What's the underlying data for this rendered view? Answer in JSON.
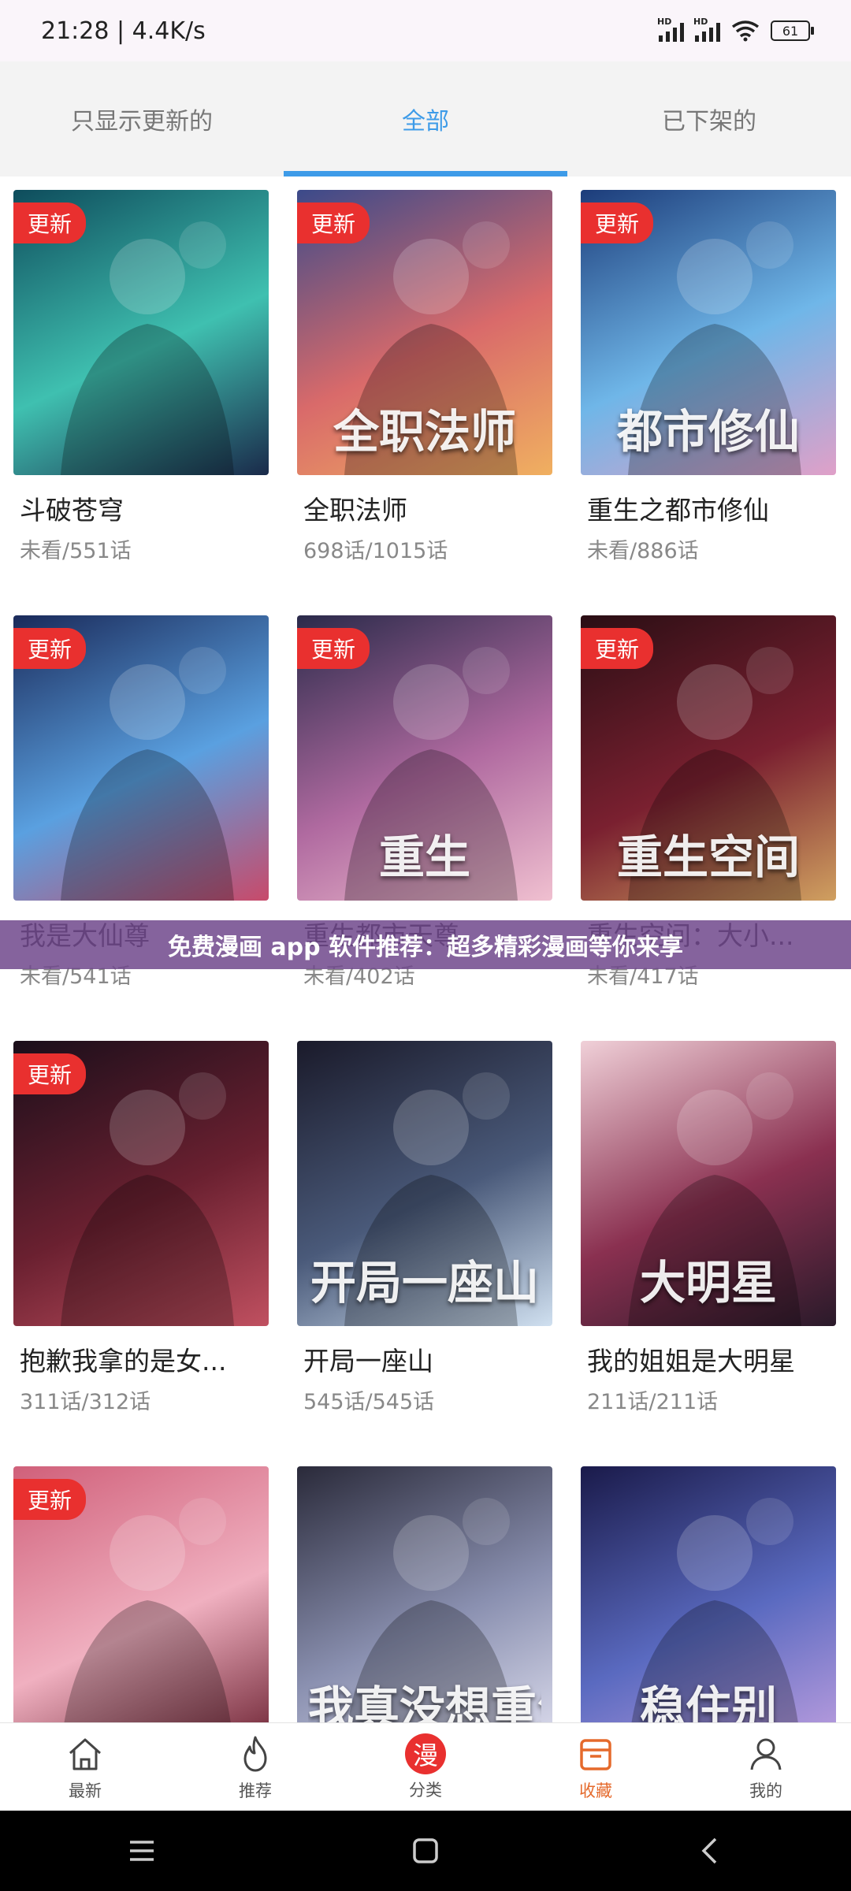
{
  "status_bar": {
    "time": "21:28",
    "speed": "4.4K/s",
    "separator": "|",
    "signal_label": "HD",
    "battery": "61"
  },
  "tabs": [
    {
      "label": "只显示更新的",
      "active": false
    },
    {
      "label": "全部",
      "active": true
    },
    {
      "label": "已下架的",
      "active": false
    }
  ],
  "badge_label": "更新",
  "comics": [
    {
      "name": "斗破苍穹",
      "progress": "未看/551话",
      "badge": true,
      "cover_text": "",
      "colors": [
        "#0e4c5c",
        "#3fc0b0",
        "#1a2a4a"
      ]
    },
    {
      "name": "全职法师",
      "progress": "698话/1015话",
      "badge": true,
      "cover_text": "全职法师",
      "colors": [
        "#3b4a8a",
        "#d96a6a",
        "#f0b060"
      ]
    },
    {
      "name": "重生之都市修仙",
      "progress": "未看/886话",
      "badge": true,
      "cover_text": "都市修仙",
      "colors": [
        "#1c3c7a",
        "#6fb6e8",
        "#e0a0c8"
      ]
    },
    {
      "name": "我是大仙尊",
      "progress": "未看/541话",
      "badge": true,
      "cover_text": "",
      "colors": [
        "#1a2a5a",
        "#5aa0e0",
        "#c84a6a"
      ]
    },
    {
      "name": "重生都市天尊",
      "progress": "未看/402话",
      "badge": true,
      "cover_text": "重生",
      "colors": [
        "#2a2a4a",
        "#b06aa0",
        "#f0c0d0"
      ]
    },
    {
      "name": "重生空间：大小...",
      "progress": "未看/417话",
      "badge": true,
      "cover_text": "重生空间",
      "colors": [
        "#2a0e14",
        "#7a2030",
        "#d0a060"
      ]
    },
    {
      "name": "抱歉我拿的是女...",
      "progress": "311话/312话",
      "badge": true,
      "cover_text": "",
      "colors": [
        "#1a0e1a",
        "#6a2030",
        "#c05060"
      ]
    },
    {
      "name": "开局一座山",
      "progress": "545话/545话",
      "badge": false,
      "cover_text": "开局一座山",
      "colors": [
        "#1a1a2a",
        "#4a5a7a",
        "#d0e0f0"
      ]
    },
    {
      "name": "我的姐姐是大明星",
      "progress": "211话/211话",
      "badge": false,
      "cover_text": "大明星",
      "colors": [
        "#f0d0d8",
        "#8a3050",
        "#2a1a2a"
      ]
    },
    {
      "name": "",
      "progress": "",
      "badge": true,
      "cover_text": "",
      "colors": [
        "#d0607a",
        "#f0b0c0",
        "#6a2030"
      ]
    },
    {
      "name": "",
      "progress": "",
      "badge": false,
      "cover_text": "我真没想重生啊",
      "colors": [
        "#2a2a3a",
        "#8a90b0",
        "#e0e0f0"
      ]
    },
    {
      "name": "",
      "progress": "",
      "badge": false,
      "cover_text": "稳住别",
      "colors": [
        "#1a1a4a",
        "#5a6ac0",
        "#c0a0e0"
      ]
    }
  ],
  "banner": {
    "text": "免费漫画 app 软件推荐：超多精彩漫画等你来享"
  },
  "bottom_nav": [
    {
      "label": "最新",
      "icon": "home-icon",
      "active": false
    },
    {
      "label": "推荐",
      "icon": "flame-icon",
      "active": false
    },
    {
      "label": "分类",
      "icon": "manga-seal-icon",
      "seal_char": "漫",
      "active": false
    },
    {
      "label": "收藏",
      "icon": "bookshelf-icon",
      "active": true
    },
    {
      "label": "我的",
      "icon": "user-icon",
      "active": false
    }
  ],
  "colors": {
    "accent_blue": "#3d9be8",
    "badge_red": "#e9302f",
    "active_orange": "#e56a2c"
  }
}
